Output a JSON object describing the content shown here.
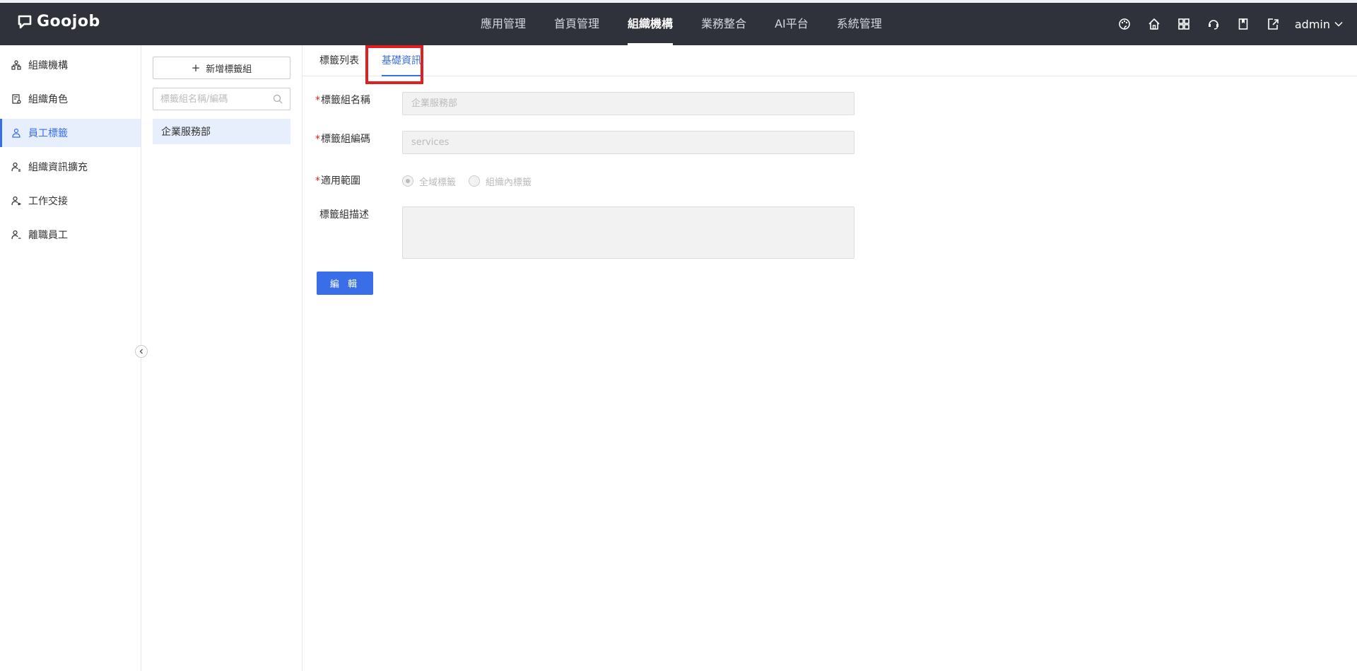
{
  "app": {
    "logo_text": "Goojob"
  },
  "nav": {
    "items": [
      {
        "label": "應用管理"
      },
      {
        "label": "首頁管理"
      },
      {
        "label": "組織機構"
      },
      {
        "label": "業務整合"
      },
      {
        "label": "AI平台"
      },
      {
        "label": "系統管理"
      }
    ],
    "active_index": 2
  },
  "top_icons": [
    "palette-icon",
    "home-icon",
    "apps-grid-icon",
    "support-icon",
    "bookmark-icon",
    "export-icon"
  ],
  "user": {
    "name": "admin"
  },
  "sidebar": {
    "items": [
      {
        "label": "組織機構",
        "icon": "org-tree-icon"
      },
      {
        "label": "組織角色",
        "icon": "role-doc-icon"
      },
      {
        "label": "員工標籤",
        "icon": "employee-tag-icon"
      },
      {
        "label": "組織資訊擴充",
        "icon": "user-extend-icon"
      },
      {
        "label": "工作交接",
        "icon": "user-handover-icon"
      },
      {
        "label": "離職員工",
        "icon": "user-leave-icon"
      }
    ],
    "active_index": 2
  },
  "panel": {
    "add_button_label": "新增標籤組",
    "search_placeholder": "標籤組名稱/編碼",
    "groups": [
      {
        "label": "企業服務部"
      }
    ]
  },
  "tabs": [
    {
      "label": "標籤列表"
    },
    {
      "label": "基礎資訊"
    }
  ],
  "active_tab_index": 1,
  "form": {
    "name": {
      "label": "標籤組名稱",
      "value": "企業服務部",
      "required": "*"
    },
    "code": {
      "label": "標籤組編碼",
      "value": "services",
      "required": "*"
    },
    "scope": {
      "label": "適用範圍",
      "required": "*",
      "options": [
        {
          "label": "全域標籤",
          "checked": true
        },
        {
          "label": "組織內標籤",
          "checked": false
        }
      ]
    },
    "description": {
      "label": "標籤組描述",
      "value": ""
    },
    "edit_button_label": "編 輯"
  },
  "colors": {
    "topbar": "#2f323a",
    "accent": "#3a6ee8",
    "highlight_box": "#e02020"
  }
}
